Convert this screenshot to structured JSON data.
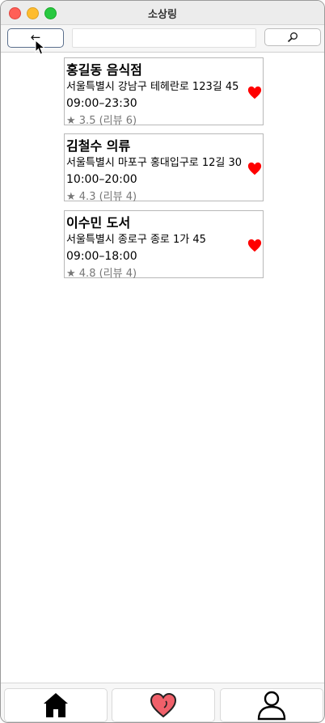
{
  "window": {
    "title": "소상링"
  },
  "toolbar": {
    "back_label": "←",
    "address_value": "",
    "search_icon": "magnifier-icon"
  },
  "stores": [
    {
      "name": "홍길동 음식점",
      "address": "서울특별시 강남구 테헤란로 123길 45",
      "hours": "09:00–23:30",
      "rating": "★ 3.5 (리뷰 6)",
      "favorite": true
    },
    {
      "name": "김철수 의류",
      "address": "서울특별시 마포구 홍대입구로 12길 30",
      "hours": "10:00–20:00",
      "rating": "★ 4.3 (리뷰 4)",
      "favorite": true
    },
    {
      "name": "이수민 도서",
      "address": "서울특별시 종로구 종로 1가 45",
      "hours": "09:00–18:00",
      "rating": "★ 4.8 (리뷰 4)",
      "favorite": true
    }
  ],
  "tabs": [
    {
      "icon": "home-icon"
    },
    {
      "icon": "heart-icon"
    },
    {
      "icon": "user-icon"
    }
  ],
  "colors": {
    "heart": "#ff0000",
    "heart_tab": "#f0606a",
    "rating": "#777777"
  }
}
